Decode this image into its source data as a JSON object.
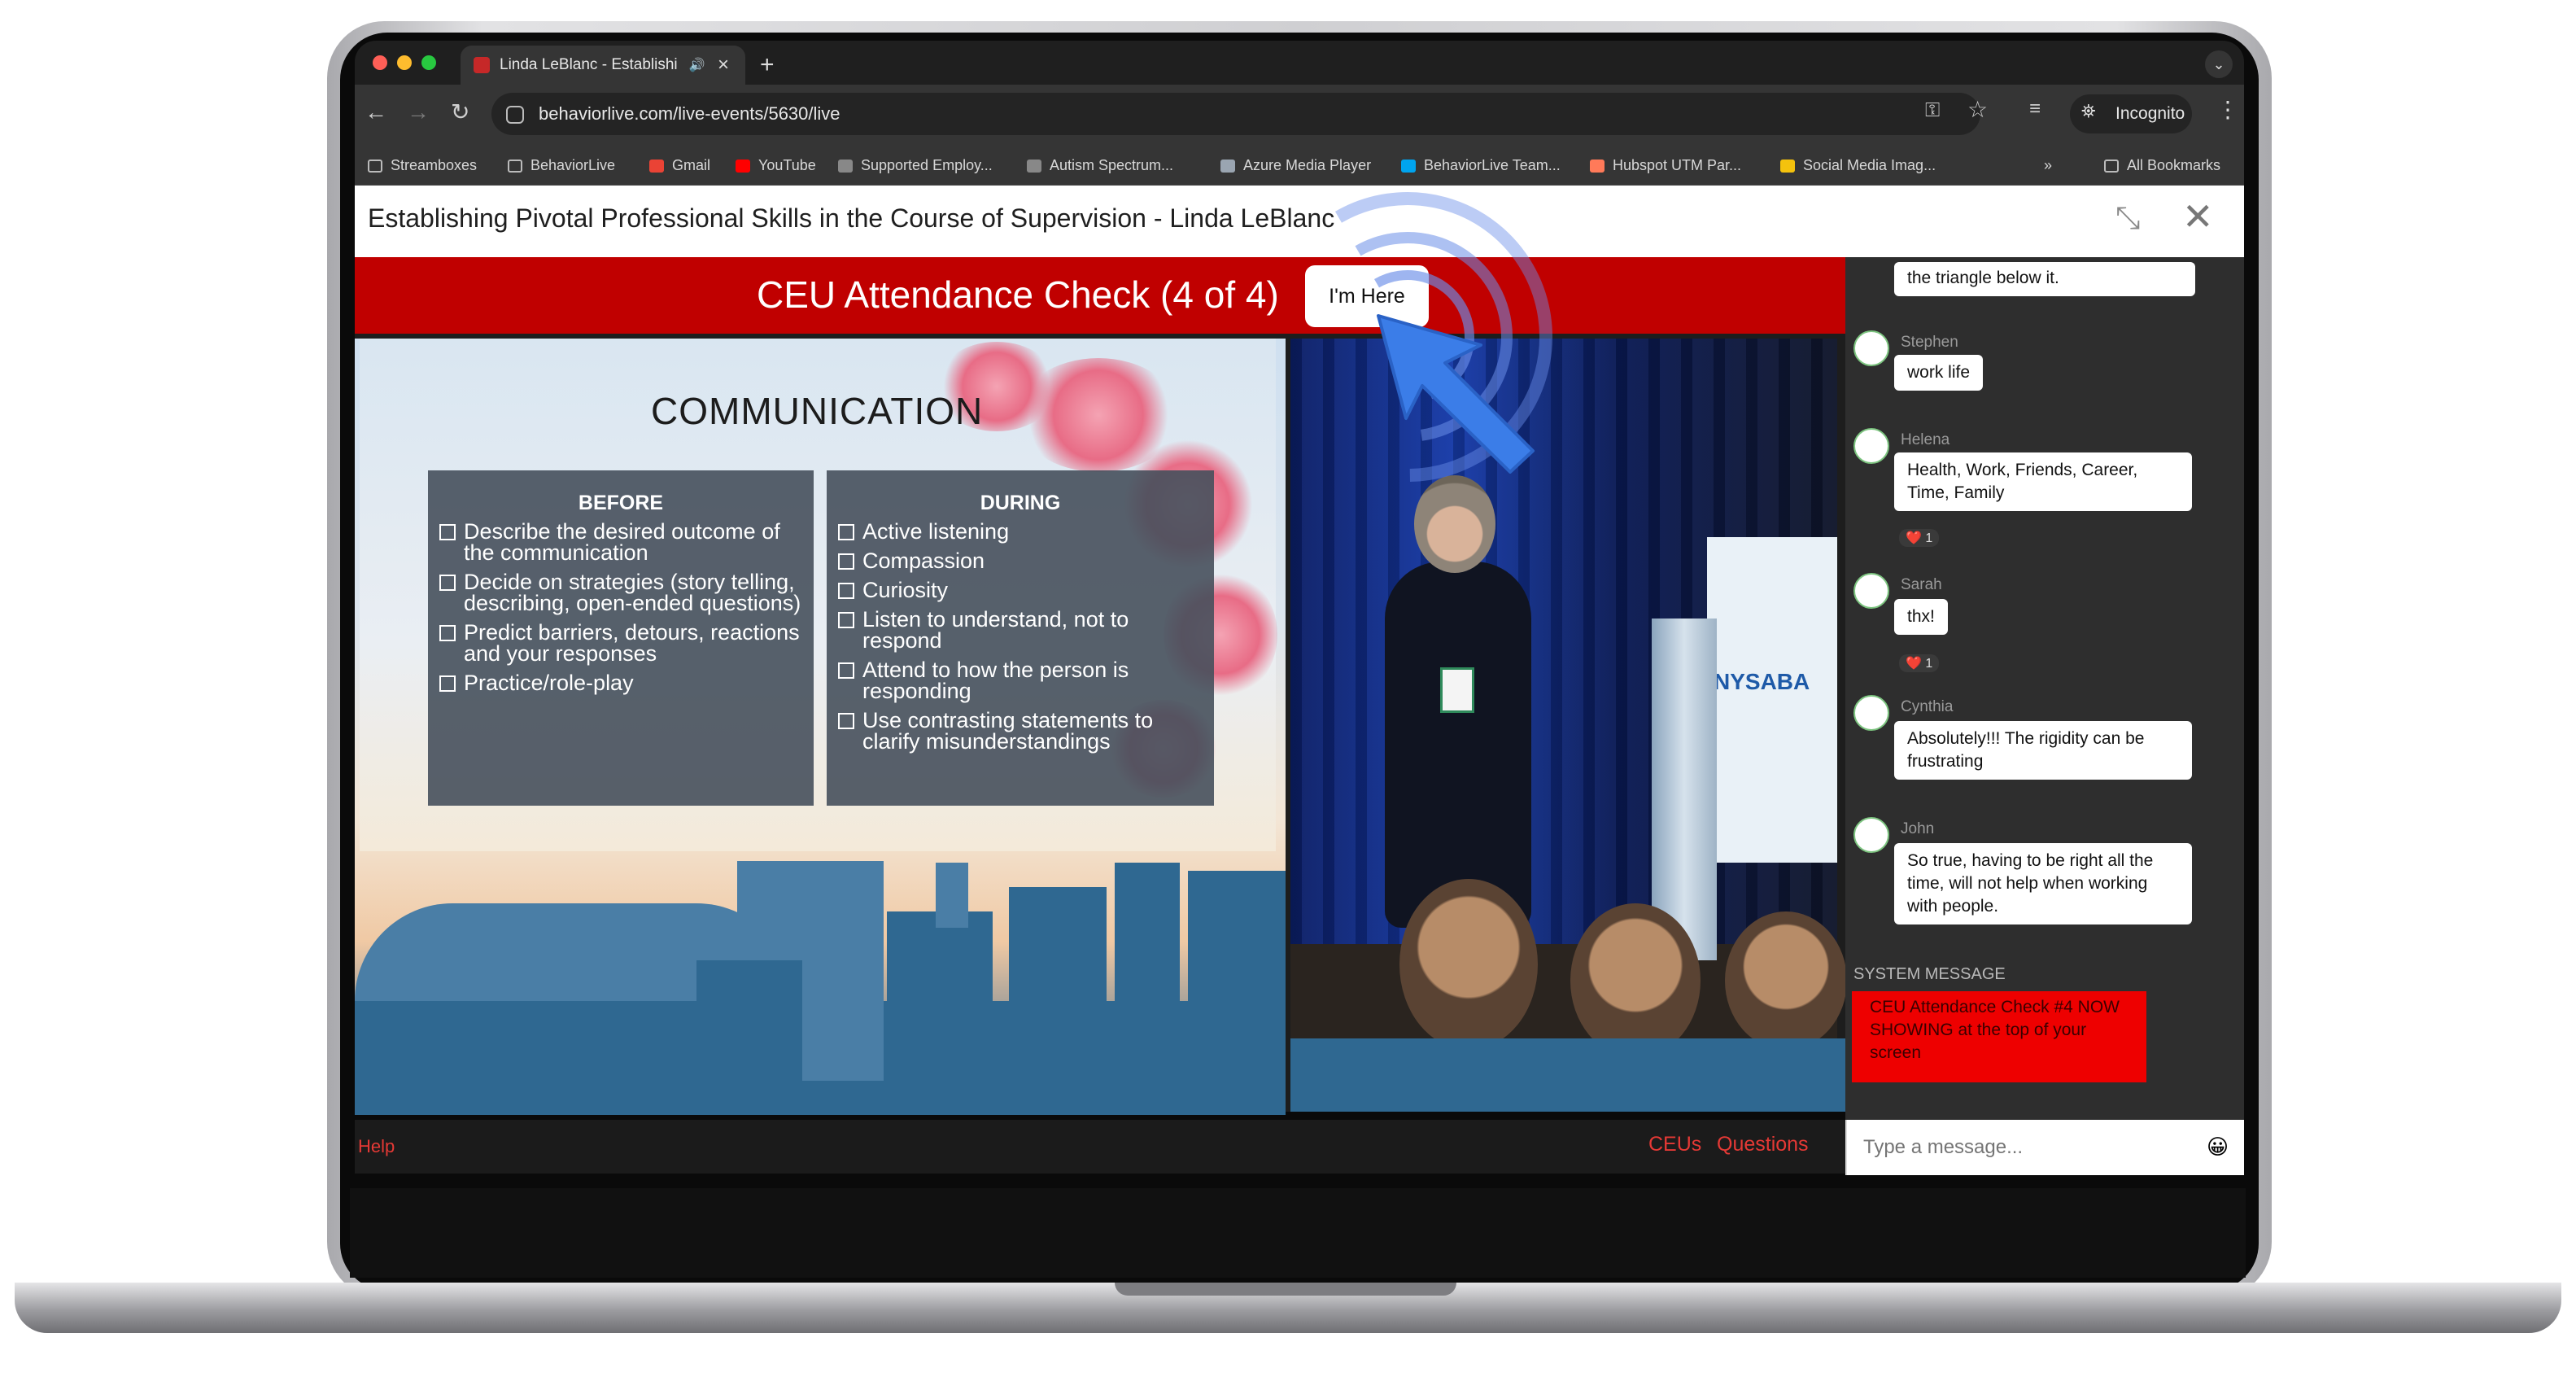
{
  "browser": {
    "tab_title": "Linda LeBlanc - Establishi",
    "url": "behaviorlive.com/live-events/5630/live",
    "incognito_label": "Incognito",
    "bookmarks": [
      {
        "label": "Streamboxes",
        "icon": "folder-icon",
        "color": "#bbbbbb"
      },
      {
        "label": "BehaviorLive",
        "icon": "folder-icon",
        "color": "#bbbbbb"
      },
      {
        "label": "Gmail",
        "icon": "gmail-icon",
        "color": "#ea4335"
      },
      {
        "label": "YouTube",
        "icon": "youtube-icon",
        "color": "#ff0000"
      },
      {
        "label": "Supported Employ...",
        "icon": "page-icon",
        "color": "#888888"
      },
      {
        "label": "Autism Spectrum...",
        "icon": "page-icon",
        "color": "#888888"
      },
      {
        "label": "Azure Media Player",
        "icon": "azure-icon",
        "color": "#9aa5b1"
      },
      {
        "label": "BehaviorLive Team...",
        "icon": "microsoft-icon",
        "color": "#00a4ef"
      },
      {
        "label": "Hubspot UTM Par...",
        "icon": "hubspot-icon",
        "color": "#ff7a59"
      },
      {
        "label": "Social Media Imag...",
        "icon": "bulb-icon",
        "color": "#f4c20d"
      }
    ],
    "all_bookmarks": "All Bookmarks",
    "overflow": "»"
  },
  "page": {
    "title": "Establishing Pivotal Professional Skills in the Course of Supervision - Linda LeBlanc",
    "attendance_text": "CEU Attendance Check (4 of 4)",
    "im_here_label": "I'm Here",
    "help_label": "Help",
    "ceus_label": "CEUs",
    "questions_label": "Questions"
  },
  "slide": {
    "heading": "COMMUNICATION",
    "before": {
      "title": "BEFORE",
      "items": [
        "Describe the desired outcome of the communication",
        "Decide on strategies (story telling, describing, open-ended questions)",
        "Predict barriers, detours, reactions and your responses",
        "Practice/role-play"
      ]
    },
    "during": {
      "title": "DURING",
      "items": [
        "Active listening",
        "Compassion",
        "Curiosity",
        "Listen to understand, not to respond",
        "Attend to how the person is responding",
        "Use contrasting statements to clarify misunderstandings"
      ]
    }
  },
  "video": {
    "banner_text": "NYSABA"
  },
  "chat": {
    "messages": [
      {
        "user": "",
        "text": "the triangle below it.",
        "reaction": ""
      },
      {
        "user": "Stephen",
        "text": "work life",
        "reaction": ""
      },
      {
        "user": "Helena",
        "text": "Health, Work, Friends, Career, Time, Family",
        "reaction": "❤️ 1"
      },
      {
        "user": "Sarah",
        "text": "thx!",
        "reaction": "❤️ 1"
      },
      {
        "user": "Cynthia",
        "text": "Absolutely!!! The rigidity can be frustrating",
        "reaction": ""
      },
      {
        "user": "John",
        "text": "So true, having to be right all the time, will not help when working with people.",
        "reaction": ""
      }
    ],
    "system_label": "SYSTEM MESSAGE",
    "system_text": "CEU Attendance Check #4 NOW SHOWING at the top of your screen",
    "input_placeholder": "Type a message...",
    "emoji": "😀"
  }
}
